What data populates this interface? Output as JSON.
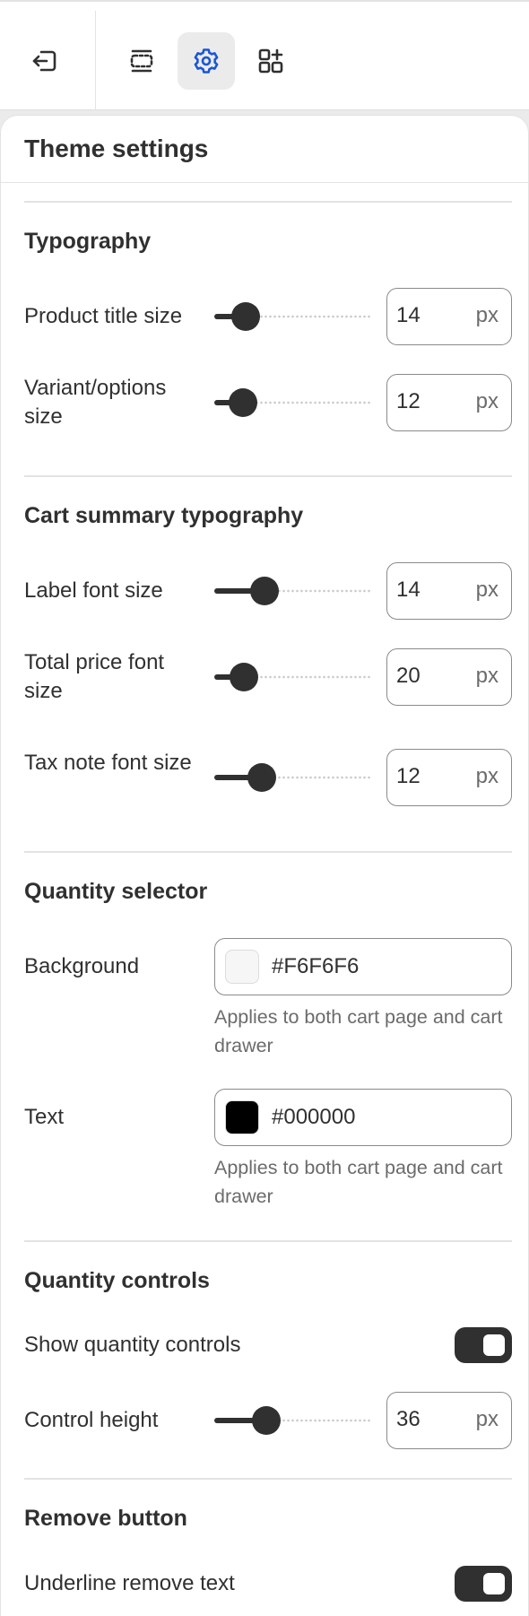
{
  "toolbar": {
    "buttons": [
      {
        "name": "exit-icon",
        "active": false
      },
      {
        "name": "sections-icon",
        "active": false
      },
      {
        "name": "settings-gear-icon",
        "active": true
      },
      {
        "name": "apps-icon",
        "active": false
      }
    ]
  },
  "panel": {
    "title": "Theme settings",
    "typography": {
      "title": "Typography",
      "product_title_size": {
        "label": "Product title size",
        "value": "14",
        "unit": "px",
        "level": 0.2
      },
      "variant_options_size": {
        "label": "Variant/options size",
        "value": "12",
        "unit": "px",
        "level": 0.18
      }
    },
    "cart_summary": {
      "title": "Cart summary typography",
      "label_font_size": {
        "label": "Label font size",
        "value": "14",
        "unit": "px",
        "level": 0.32
      },
      "total_price_font_size": {
        "label": "Total price font size",
        "value": "20",
        "unit": "px",
        "level": 0.19
      },
      "tax_note_font_size": {
        "label": "Tax note font size",
        "value": "12",
        "unit": "px",
        "level": 0.3
      }
    },
    "quantity_selector": {
      "title": "Quantity selector",
      "background": {
        "label": "Background",
        "hex": "#F6F6F6",
        "swatch": "#F6F6F6",
        "help": "Applies to both cart page and cart drawer"
      },
      "text": {
        "label": "Text",
        "hex": "#000000",
        "swatch": "#000000",
        "help": "Applies to both cart page and cart drawer"
      }
    },
    "quantity_controls": {
      "title": "Quantity controls",
      "show_label": "Show quantity controls",
      "show_enabled": true,
      "control_height": {
        "label": "Control height",
        "value": "36",
        "unit": "px",
        "level": 0.33
      }
    },
    "remove_button": {
      "title": "Remove button",
      "underline_label": "Underline remove text",
      "underline_enabled": true
    }
  },
  "colors": {
    "accent": "#303030",
    "active_icon": "#1a56d6",
    "icon": "#303030"
  }
}
